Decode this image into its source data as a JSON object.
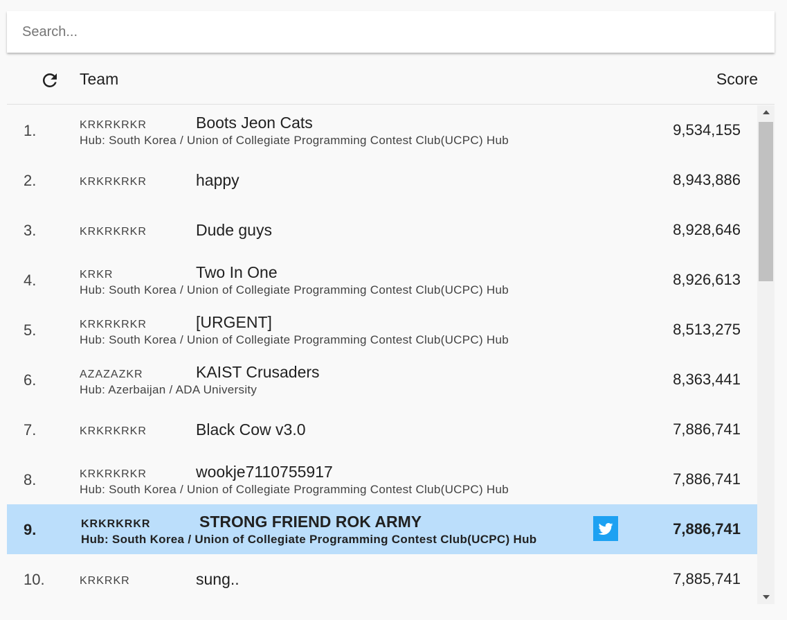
{
  "search": {
    "placeholder": "Search..."
  },
  "header": {
    "team_label": "Team",
    "score_label": "Score",
    "refresh_icon": "refresh-icon"
  },
  "rows": [
    {
      "rank": "1.",
      "code": "KRKRKRKR",
      "name": "Boots Jeon Cats",
      "hub": "Hub: South Korea / Union of Collegiate Programming Contest Club(UCPC) Hub",
      "score": "9,534,155"
    },
    {
      "rank": "2.",
      "code": "KRKRKRKR",
      "name": "happy",
      "hub": "",
      "score": "8,943,886"
    },
    {
      "rank": "3.",
      "code": "KRKRKRKR",
      "name": "Dude guys",
      "hub": "",
      "score": "8,928,646"
    },
    {
      "rank": "4.",
      "code": "KRKR",
      "name": "Two In One",
      "hub": "Hub: South Korea / Union of Collegiate Programming Contest Club(UCPC) Hub",
      "score": "8,926,613"
    },
    {
      "rank": "5.",
      "code": "KRKRKRKR",
      "name": "[URGENT]",
      "hub": "Hub: South Korea / Union of Collegiate Programming Contest Club(UCPC) Hub",
      "score": "8,513,275"
    },
    {
      "rank": "6.",
      "code": "AZAZAZKR",
      "name": "KAIST Crusaders",
      "hub": "Hub: Azerbaijan / ADA University",
      "score": "8,363,441"
    },
    {
      "rank": "7.",
      "code": "KRKRKRKR",
      "name": "Black Cow v3.0",
      "hub": "",
      "score": "7,886,741"
    },
    {
      "rank": "8.",
      "code": "KRKRKRKR",
      "name": "wookje7110755917",
      "hub": "Hub: South Korea / Union of Collegiate Programming Contest Club(UCPC) Hub",
      "score": "7,886,741"
    },
    {
      "rank": "9.",
      "code": "KRKRKRKR",
      "name": "STRONG FRIEND ROK ARMY",
      "hub": "Hub: South Korea / Union of Collegiate Programming Contest Club(UCPC) Hub",
      "score": "7,886,741",
      "highlighted": true,
      "twitter_icon": "twitter-icon"
    },
    {
      "rank": "10.",
      "code": "KRKRKR",
      "name": "sung..",
      "hub": "",
      "score": "7,885,741"
    }
  ],
  "colors": {
    "highlight": "#bbdefb",
    "twitter": "#1da1f2",
    "background": "#f9f9f9"
  }
}
